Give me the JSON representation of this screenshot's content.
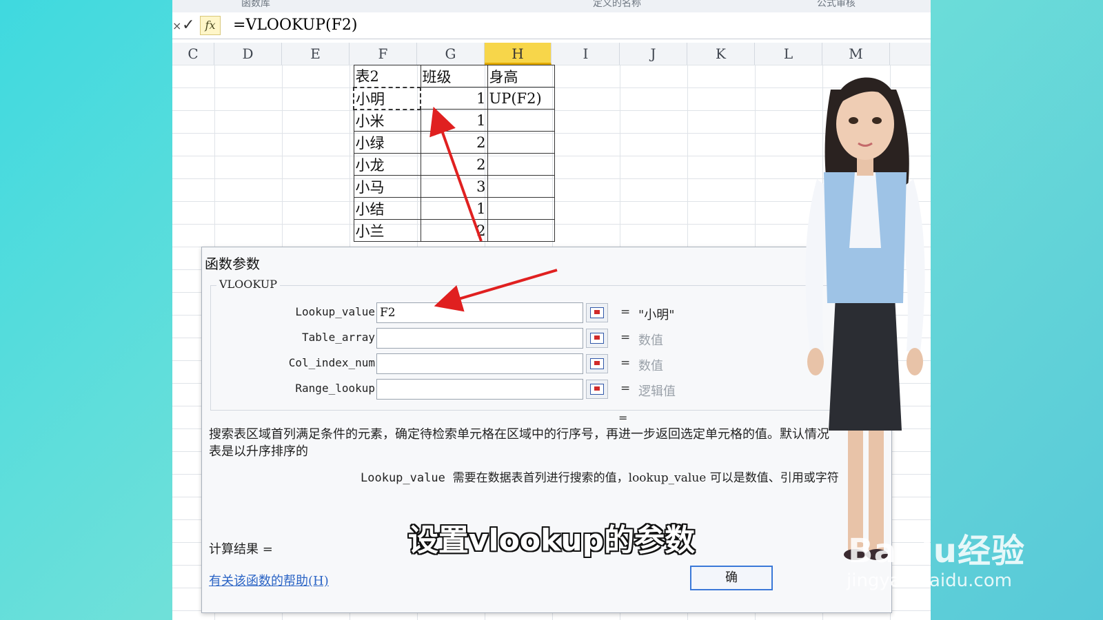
{
  "ribbon": {
    "groups": [
      "函数库",
      "定义的名称",
      "公式审核"
    ]
  },
  "formula_bar": {
    "cancel_glyph": "×",
    "enter_glyph": "✓",
    "fx_label": "fx",
    "formula": "=VLOOKUP(F2)"
  },
  "columns": [
    "C",
    "D",
    "E",
    "F",
    "G",
    "H",
    "I",
    "J",
    "K",
    "L",
    "M"
  ],
  "active_column": "H",
  "sheet_table": {
    "headers": [
      "表2",
      "班级",
      "身高"
    ],
    "rows": [
      {
        "name": "小明",
        "class": "1",
        "height": "UP(F2)"
      },
      {
        "name": "小米",
        "class": "1",
        "height": ""
      },
      {
        "name": "小绿",
        "class": "2",
        "height": ""
      },
      {
        "name": "小龙",
        "class": "2",
        "height": ""
      },
      {
        "name": "小马",
        "class": "3",
        "height": ""
      },
      {
        "name": "小结",
        "class": "1",
        "height": ""
      },
      {
        "name": "小兰",
        "class": "2",
        "height": ""
      }
    ]
  },
  "dialog": {
    "title": "函数参数",
    "function_name": "VLOOKUP",
    "args": [
      {
        "name": "Lookup_value",
        "value": "F2",
        "eq": "=",
        "result": "\"小明\""
      },
      {
        "name": "Table_array",
        "value": "",
        "eq": "=",
        "result": "数值"
      },
      {
        "name": "Col_index_num",
        "value": "",
        "eq": "=",
        "result": "数值"
      },
      {
        "name": "Range_lookup",
        "value": "",
        "eq": "=",
        "result": "逻辑值"
      }
    ],
    "result_eq": "=",
    "description_line1": "搜索表区域首列满足条件的元素，确定待检索单元格在区域中的行序号，再进一步返回选定单元格的值。默认情况",
    "description_line2": "表是以升序排序的",
    "param_name": "Lookup_value",
    "param_desc": "需要在数据表首列进行搜索的值，lookup_value 可以是数值、引用或字符",
    "calc_result": "计算结果 =",
    "help_link": "有关该函数的帮助(H)",
    "ok_button": "确"
  },
  "subtitle": "设置vlookup的参数",
  "watermark": {
    "logo": "Baidu经验",
    "url": "jingyan.baidu.com"
  },
  "colors": {
    "background": "#3fd9df",
    "active_column": "#f7d64a",
    "arrow": "#e02020",
    "link": "#2b64c5"
  }
}
